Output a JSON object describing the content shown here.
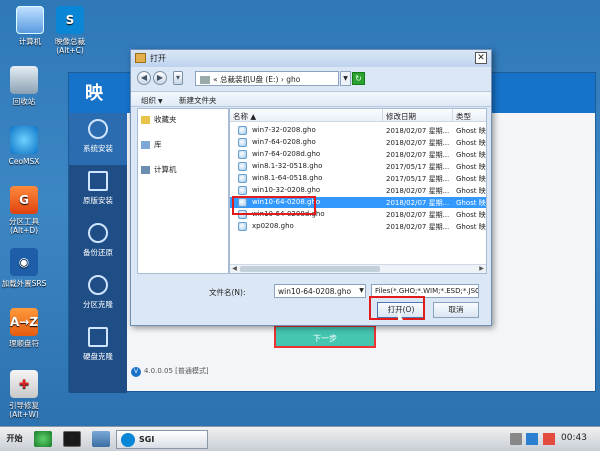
{
  "desktop_icons": [
    {
      "label": "计算机",
      "icon": "computer-icon"
    },
    {
      "label": "映像总裁",
      "sub": "(Alt+C)",
      "icon": "ghost-icon"
    },
    {
      "label": "回收站",
      "icon": "recycle-bin-icon"
    },
    {
      "label": "CeoMSX",
      "icon": "ceomsx-icon"
    },
    {
      "label": "分区工具",
      "sub": "(Alt+D)",
      "icon": "partition-tool-icon"
    },
    {
      "label": "加载外置SRS",
      "icon": "srs-icon"
    },
    {
      "label": "理顺盘符",
      "icon": "drive-letter-icon"
    },
    {
      "label": "引导修复",
      "sub": "(Alt+W)",
      "icon": "boot-repair-icon"
    }
  ],
  "app": {
    "logo": "映",
    "sidebar": [
      "系统安装",
      "原版安装",
      "备份还原",
      "分区克隆",
      "硬盘克隆"
    ],
    "next_button": "下一步",
    "version": "4.0.0.05 [普通模式]",
    "version_badge": "V"
  },
  "dialog": {
    "title": "打开",
    "close": "✕",
    "address": "« 总裁装机U盘 (E:) › gho",
    "toolbar": {
      "organize": "组织",
      "new_folder": "新建文件夹"
    },
    "nav": [
      "收藏夹",
      "库",
      "计算机"
    ],
    "columns": {
      "name": "名称",
      "date": "修改日期",
      "type": "类型"
    },
    "files": [
      {
        "name": "win7-32-0208.gho",
        "date": "2018/02/07 星期...",
        "type": "Ghost 映像"
      },
      {
        "name": "win7-64-0208.gho",
        "date": "2018/02/07 星期...",
        "type": "Ghost 映像"
      },
      {
        "name": "win7-64-0208d.gho",
        "date": "2018/02/07 星期...",
        "type": "Ghost 映像"
      },
      {
        "name": "win8.1-32-0518.gho",
        "date": "2017/05/17 星期...",
        "type": "Ghost 映像"
      },
      {
        "name": "win8.1-64-0518.gho",
        "date": "2017/05/17 星期...",
        "type": "Ghost 映像"
      },
      {
        "name": "win10-32-0208.gho",
        "date": "2018/02/07 星期...",
        "type": "Ghost 映像"
      },
      {
        "name": "win10-64-0208.gho",
        "date": "2018/02/07 星期...",
        "type": "Ghost 映像",
        "selected": true
      },
      {
        "name": "win10-64-0208d.gho",
        "date": "2018/02/07 星期...",
        "type": "Ghost 映像"
      },
      {
        "name": "xp0208.gho",
        "date": "2018/02/07 星期...",
        "type": "Ghost 映像"
      }
    ],
    "filename_label": "文件名(N):",
    "filename_value": "win10-64-0208.gho",
    "filetype_value": "Files(*.GHO;*.WIM;*.ESD;*.JSO",
    "open_button": "打开(O)",
    "cancel_button": "取消"
  },
  "taskbar": {
    "start": "开始",
    "task_label": "SGI",
    "clock": "00:43"
  }
}
